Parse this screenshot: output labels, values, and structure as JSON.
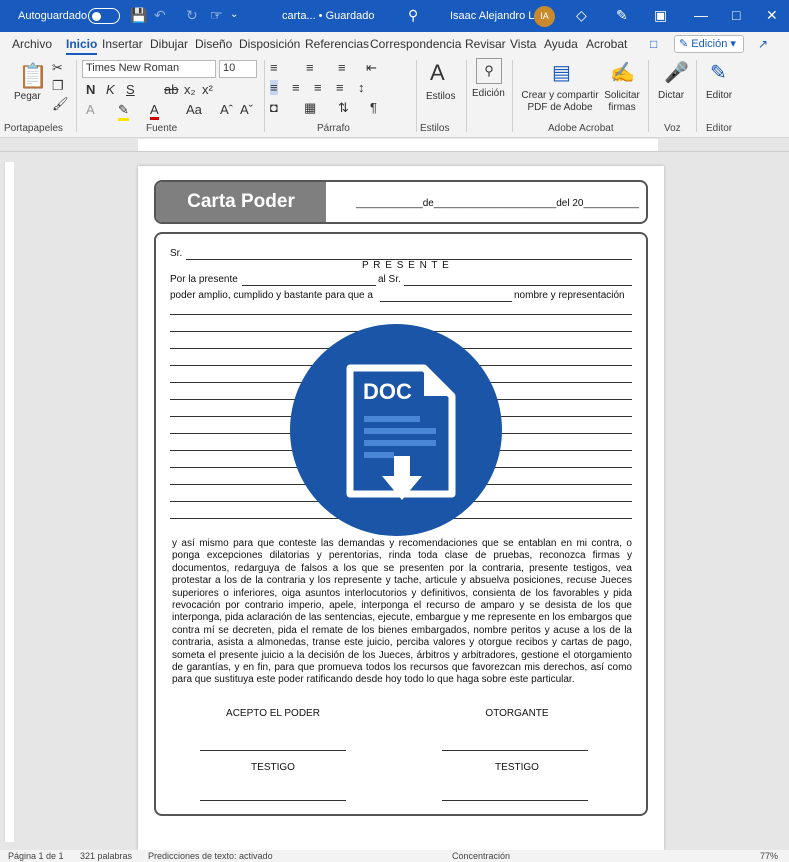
{
  "titlebar": {
    "autosave_label": "Autoguardado",
    "document_name": "carta... • Guardado",
    "user_name": "Isaac Alejandro L",
    "user_initials": "IA",
    "accent_color": "#185abd"
  },
  "menu": {
    "tabs": [
      "Archivo",
      "Inicio",
      "Insertar",
      "Dibujar",
      "Diseño",
      "Disposición",
      "Referencias",
      "Correspondencia",
      "Revisar",
      "Vista",
      "Ayuda",
      "Acrobat"
    ],
    "active_tab": "Inicio",
    "edit_mode": "Edición"
  },
  "ribbon": {
    "paste_label": "Pegar",
    "font_name": "Times New Roman",
    "font_size": "10",
    "styles_label": "Estilos",
    "editing_label": "Edición",
    "create_pdf_label": "Crear y compartir PDF de Adobe",
    "request_sign_label": "Solicitar firmas",
    "dictate_label": "Dictar",
    "editor_label": "Editor",
    "groups": {
      "clipboard": "Portapapeles",
      "font": "Fuente",
      "paragraph": "Párrafo",
      "styles": "Estilos",
      "acrobat": "Adobe Acrobat",
      "voice": "Voz",
      "editor": "Editor"
    }
  },
  "document": {
    "title": "Carta Poder",
    "date_line": "____________de______________________del 20__________",
    "sr_line": "Sr.",
    "presente": "P R E S E N T E",
    "por_la_presente": "Por la presente",
    "al_sr": "al Sr.",
    "poder_line": "poder amplio, cumplido y bastante para que a",
    "nombre_rep": "nombre y representación",
    "body_paragraph": "y así mismo para que conteste las demandas y recomendaciones que se entablan en mi contra, o ponga excepciones dilatorias y perentorias, rinda toda clase de pruebas, reconozca firmas y documentos, redarguya de falsos a los que se presenten por la contraria, presente testigos, vea protestar a los de la contraria y los represente y tache, articule y absuelva posiciones, recuse Jueces superiores o inferiores, oiga asuntos interlocutorios y definitivos, consienta de los favorables y pida revocación por contrario imperio, apele, interponga el recurso de amparo y se desista de los que interponga, pida aclaración de las sentencias, ejecute, embargue y me represente en los embargos que contra mí se decreten, pida el remate de los bienes embargados, nombre peritos y acuse a los de la contraria, asista a almonedas, transe este juicio, perciba valores y otorgue recibos y cartas de pago, someta el presente juicio a la decisión de los Jueces, árbitros y arbitradores, gestione el otorgamiento de garantías, y en fin, para que promueva todos los recursos que favorezcan mis derechos, así como para que sustituya este poder ratificando desde hoy todo lo que haga sobre este particular.",
    "acepto": "ACEPTO EL PODER",
    "otorgante": "OTORGANTE",
    "testigo_1": "TESTIGO",
    "testigo_2": "TESTIGO"
  },
  "badge": {
    "label": "DOC",
    "color": "#1a55a8"
  },
  "statusbar": {
    "page": "Página 1 de 1",
    "words": "321 palabras",
    "predictions": "Predicciones de texto: activado",
    "focus": "Concentración",
    "zoom": "77%"
  }
}
